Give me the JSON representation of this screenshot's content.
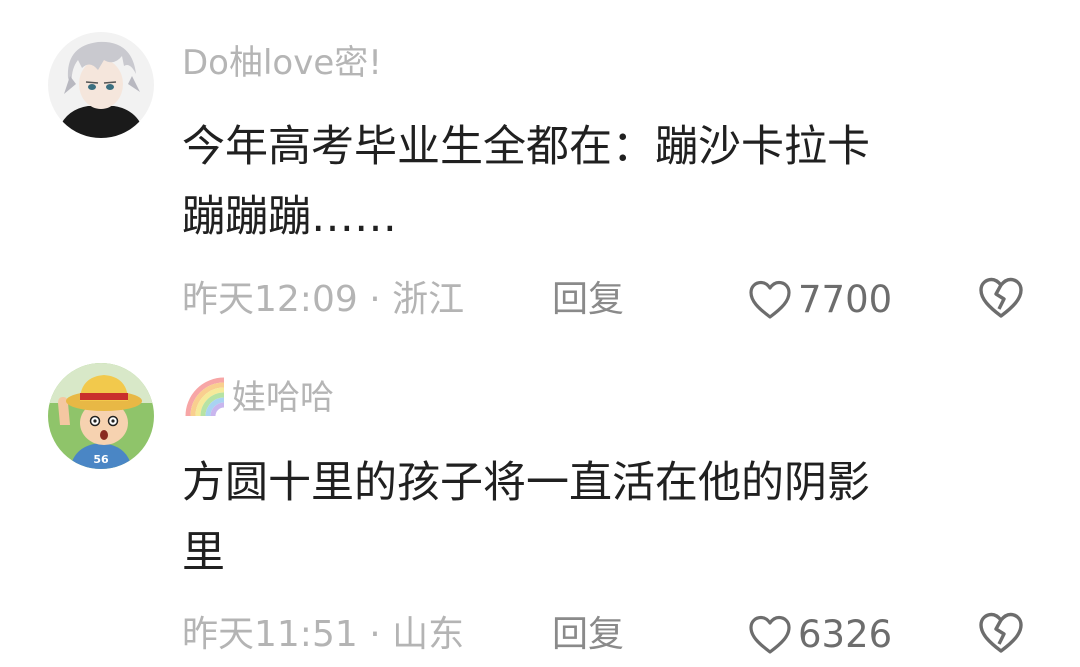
{
  "comments": [
    {
      "username": "Do柚love密!",
      "content_line1": "今年高考毕业生全都在：蹦沙卡拉卡",
      "content_line2": "蹦蹦蹦……",
      "time_location": "昨天12:09 · 浙江",
      "reply_label": "回复",
      "like_count": "7700",
      "avatar_icon": "anime-boy-white-hair-avatar"
    },
    {
      "username": "娃哈哈",
      "username_prefix_icon": "rainbow-icon",
      "content_line1": "方圆十里的孩子将一直活在他的阴影",
      "content_line2": "里",
      "time_location": "昨天11:51 · 山东",
      "reply_label": "回复",
      "like_count": "6326",
      "avatar_icon": "straw-hat-boy-avatar"
    }
  ],
  "colors": {
    "username": "#b5b5b5",
    "content": "#202020",
    "meta": "#b4b4b4",
    "icons": "#6d6d6d"
  }
}
